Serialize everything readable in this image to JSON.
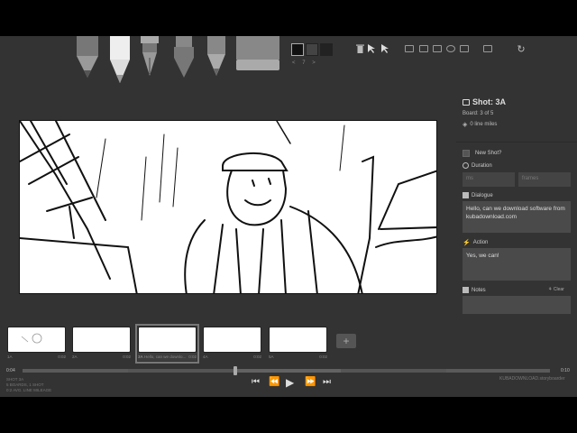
{
  "toolbar": {
    "tools": [
      {
        "name": "pencil"
      },
      {
        "name": "light-pencil"
      },
      {
        "name": "pen"
      },
      {
        "name": "brush"
      },
      {
        "name": "note-pen"
      },
      {
        "name": "eraser"
      }
    ],
    "pager_prev": "<",
    "pager_num": "7",
    "pager_next": ">"
  },
  "shot": {
    "title": "Shot: 3A",
    "board": "Board: 3 of 5",
    "line_miles": "0 line miles",
    "new_shot_label": "New Shot?",
    "duration_label": "Duration",
    "duration_ms_placeholder": "ms",
    "duration_frames_placeholder": "frames",
    "dialogue_label": "Dialogue",
    "dialogue_value": "Hello, can we download software from kubadownload.com",
    "action_label": "Action",
    "action_value": "Yes, we can!",
    "notes_label": "Notes",
    "clear_label": "Clear"
  },
  "thumbnails": [
    {
      "id": "1A",
      "caption": "",
      "time": "0:02"
    },
    {
      "id": "2A",
      "caption": "",
      "time": "0:02"
    },
    {
      "id": "3A",
      "caption": "Hello, can we downlo...",
      "time": "0:02"
    },
    {
      "id": "4A",
      "caption": "",
      "time": "0:02"
    },
    {
      "id": "5A",
      "caption": "",
      "time": "0:02"
    }
  ],
  "timeline": {
    "current": "0:04",
    "total": "0:10",
    "position": 0.4
  },
  "meta": {
    "line1": "SHOT 3A",
    "line2": "5 BOARDS, 1 SHOT",
    "line3": "0:2 AVG. LINE MILEAGE"
  },
  "watermark": "KUBADOWNLOAD.storyboarder",
  "colors": {
    "app_bg": "#333333",
    "field_bg": "#444444",
    "text": "#bbbbbb"
  }
}
